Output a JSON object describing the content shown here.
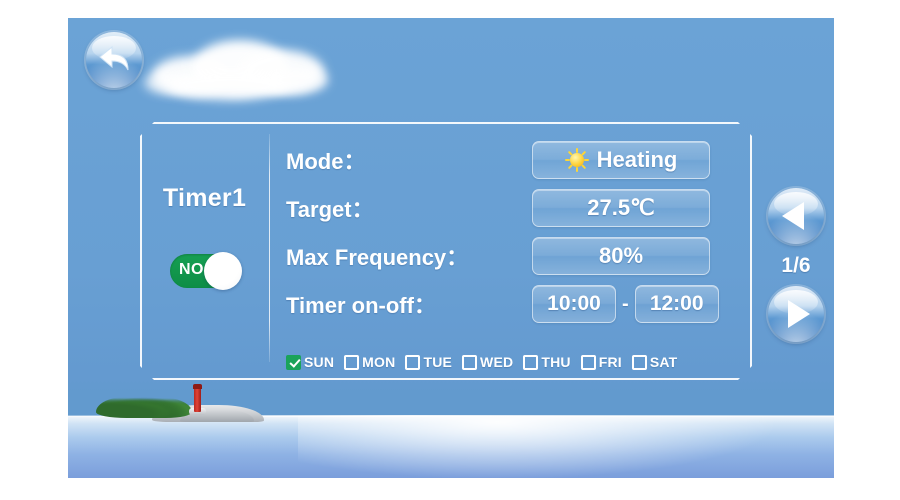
{
  "screen": {
    "background_color": "#ffffff",
    "panel_color": "#6ba3d6"
  },
  "back_button": {
    "icon": "back-arrow-icon"
  },
  "card": {
    "timer_name": "Timer1",
    "power_toggle": {
      "label": "NO",
      "state_on": true,
      "on_color": "#12964c"
    },
    "rows": [
      {
        "label": "Mode：",
        "value": "Heating",
        "icon": "sun-icon",
        "type": "mode"
      },
      {
        "label": "Target：",
        "value": "27.5℃",
        "type": "value"
      },
      {
        "label": "Max Frequency：",
        "value": "80%",
        "type": "value"
      },
      {
        "label": "Timer on-off：",
        "value_start": "10:00",
        "separator": "-",
        "value_end": "12:00",
        "type": "time-range"
      }
    ],
    "days": [
      {
        "label": "SUN",
        "checked": true
      },
      {
        "label": "MON",
        "checked": false
      },
      {
        "label": "TUE",
        "checked": false
      },
      {
        "label": "WED",
        "checked": false
      },
      {
        "label": "THU",
        "checked": false
      },
      {
        "label": "FRI",
        "checked": false
      },
      {
        "label": "SAT",
        "checked": false
      }
    ],
    "checked_color": "#1aa35a"
  },
  "navigation": {
    "prev_icon": "triangle-left-icon",
    "next_icon": "triangle-right-icon",
    "page_indicator": "1/6"
  },
  "scenery": {
    "cloud": "cloud-graphic",
    "island": "island-lighthouse-graphic",
    "sea": "sea-horizon-graphic"
  }
}
